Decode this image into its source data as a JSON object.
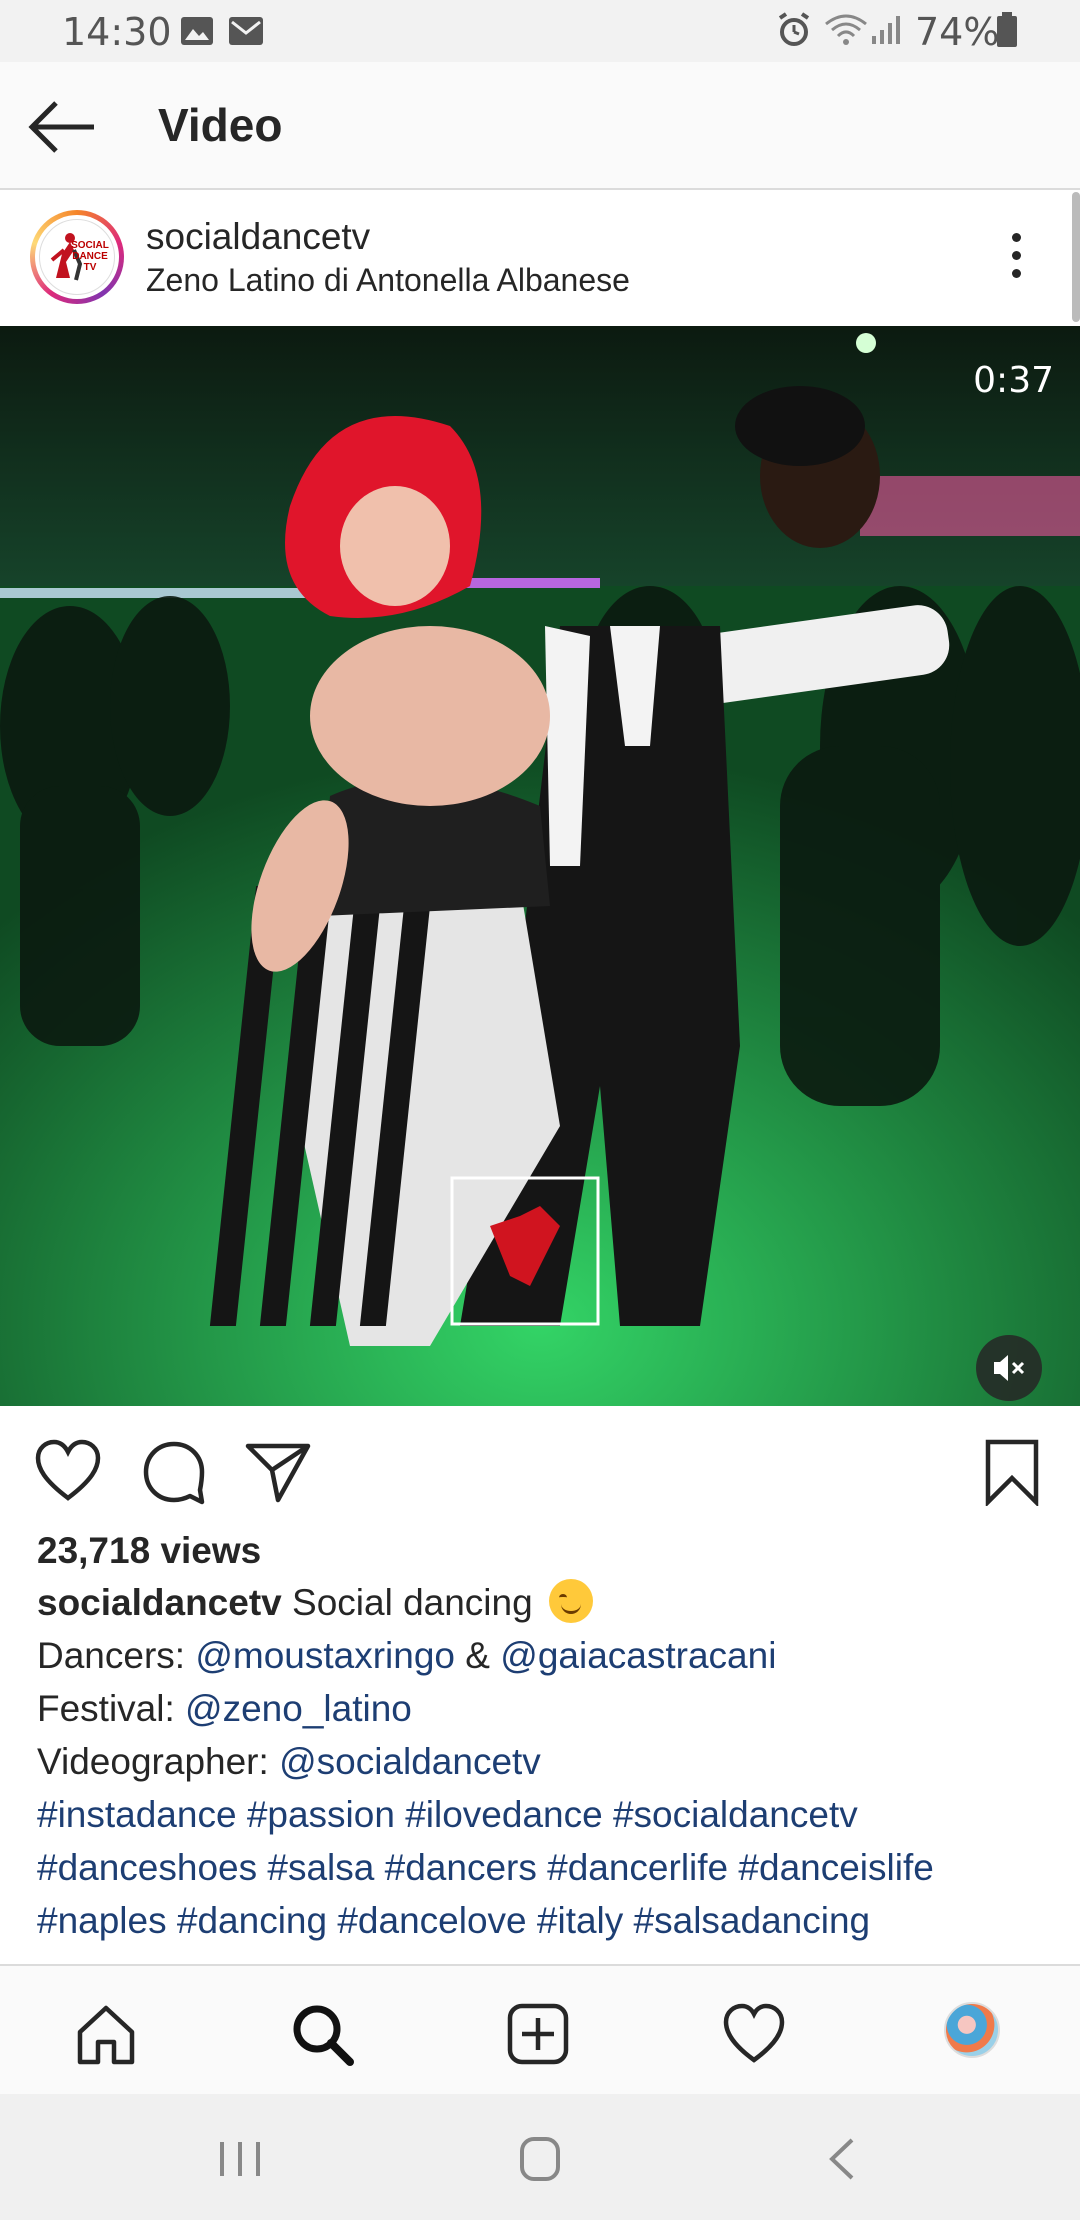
{
  "status_bar": {
    "time": "14:30",
    "battery": "74%",
    "icons": [
      "gallery-icon",
      "email-icon",
      "alarm-icon",
      "wifi-icon",
      "signal-icon",
      "battery-icon"
    ]
  },
  "header": {
    "title": "Video",
    "back_icon": "arrow-left-icon"
  },
  "post": {
    "username": "socialdancetv",
    "location": "Zeno Latino di Antonella Albanese",
    "avatar_text": "SOCIAL DANCE TV"
  },
  "video": {
    "timestamp": "0:37",
    "mute_icon": "volume-muted-icon"
  },
  "actions": {
    "icons": [
      "heart-icon",
      "comment-icon",
      "share-icon",
      "bookmark-icon"
    ]
  },
  "caption": {
    "views": "23,718 views",
    "username": "socialdancetv",
    "text": "Social dancing",
    "dancers_label": "Dancers:",
    "dancer1": "@moustaxringo",
    "amp": "&",
    "dancer2": "@gaiacastracani",
    "festival_label": "Festival:",
    "festival": "@zeno_latino",
    "videographer_label": "Videographer:",
    "videographer": "@socialdancetv",
    "hashtags_line1": "#instadance #passion #ilovedance #socialdancetv",
    "hashtags_line2": "#danceshoes #salsa #dancers #dancerlife #danceislife",
    "hashtags_line3": "#naples #dancing #dancelove #italy #salsadancing"
  },
  "bottom_nav": {
    "items": [
      "home-icon",
      "search-icon",
      "add-post-icon",
      "activity-heart-icon",
      "profile-avatar"
    ]
  },
  "system_nav": {
    "items": [
      "recent-apps-icon",
      "home-button-icon",
      "back-icon"
    ]
  },
  "colors": {
    "link": "#1d3e73",
    "text": "#262626",
    "video_green": "#1fb54e"
  }
}
